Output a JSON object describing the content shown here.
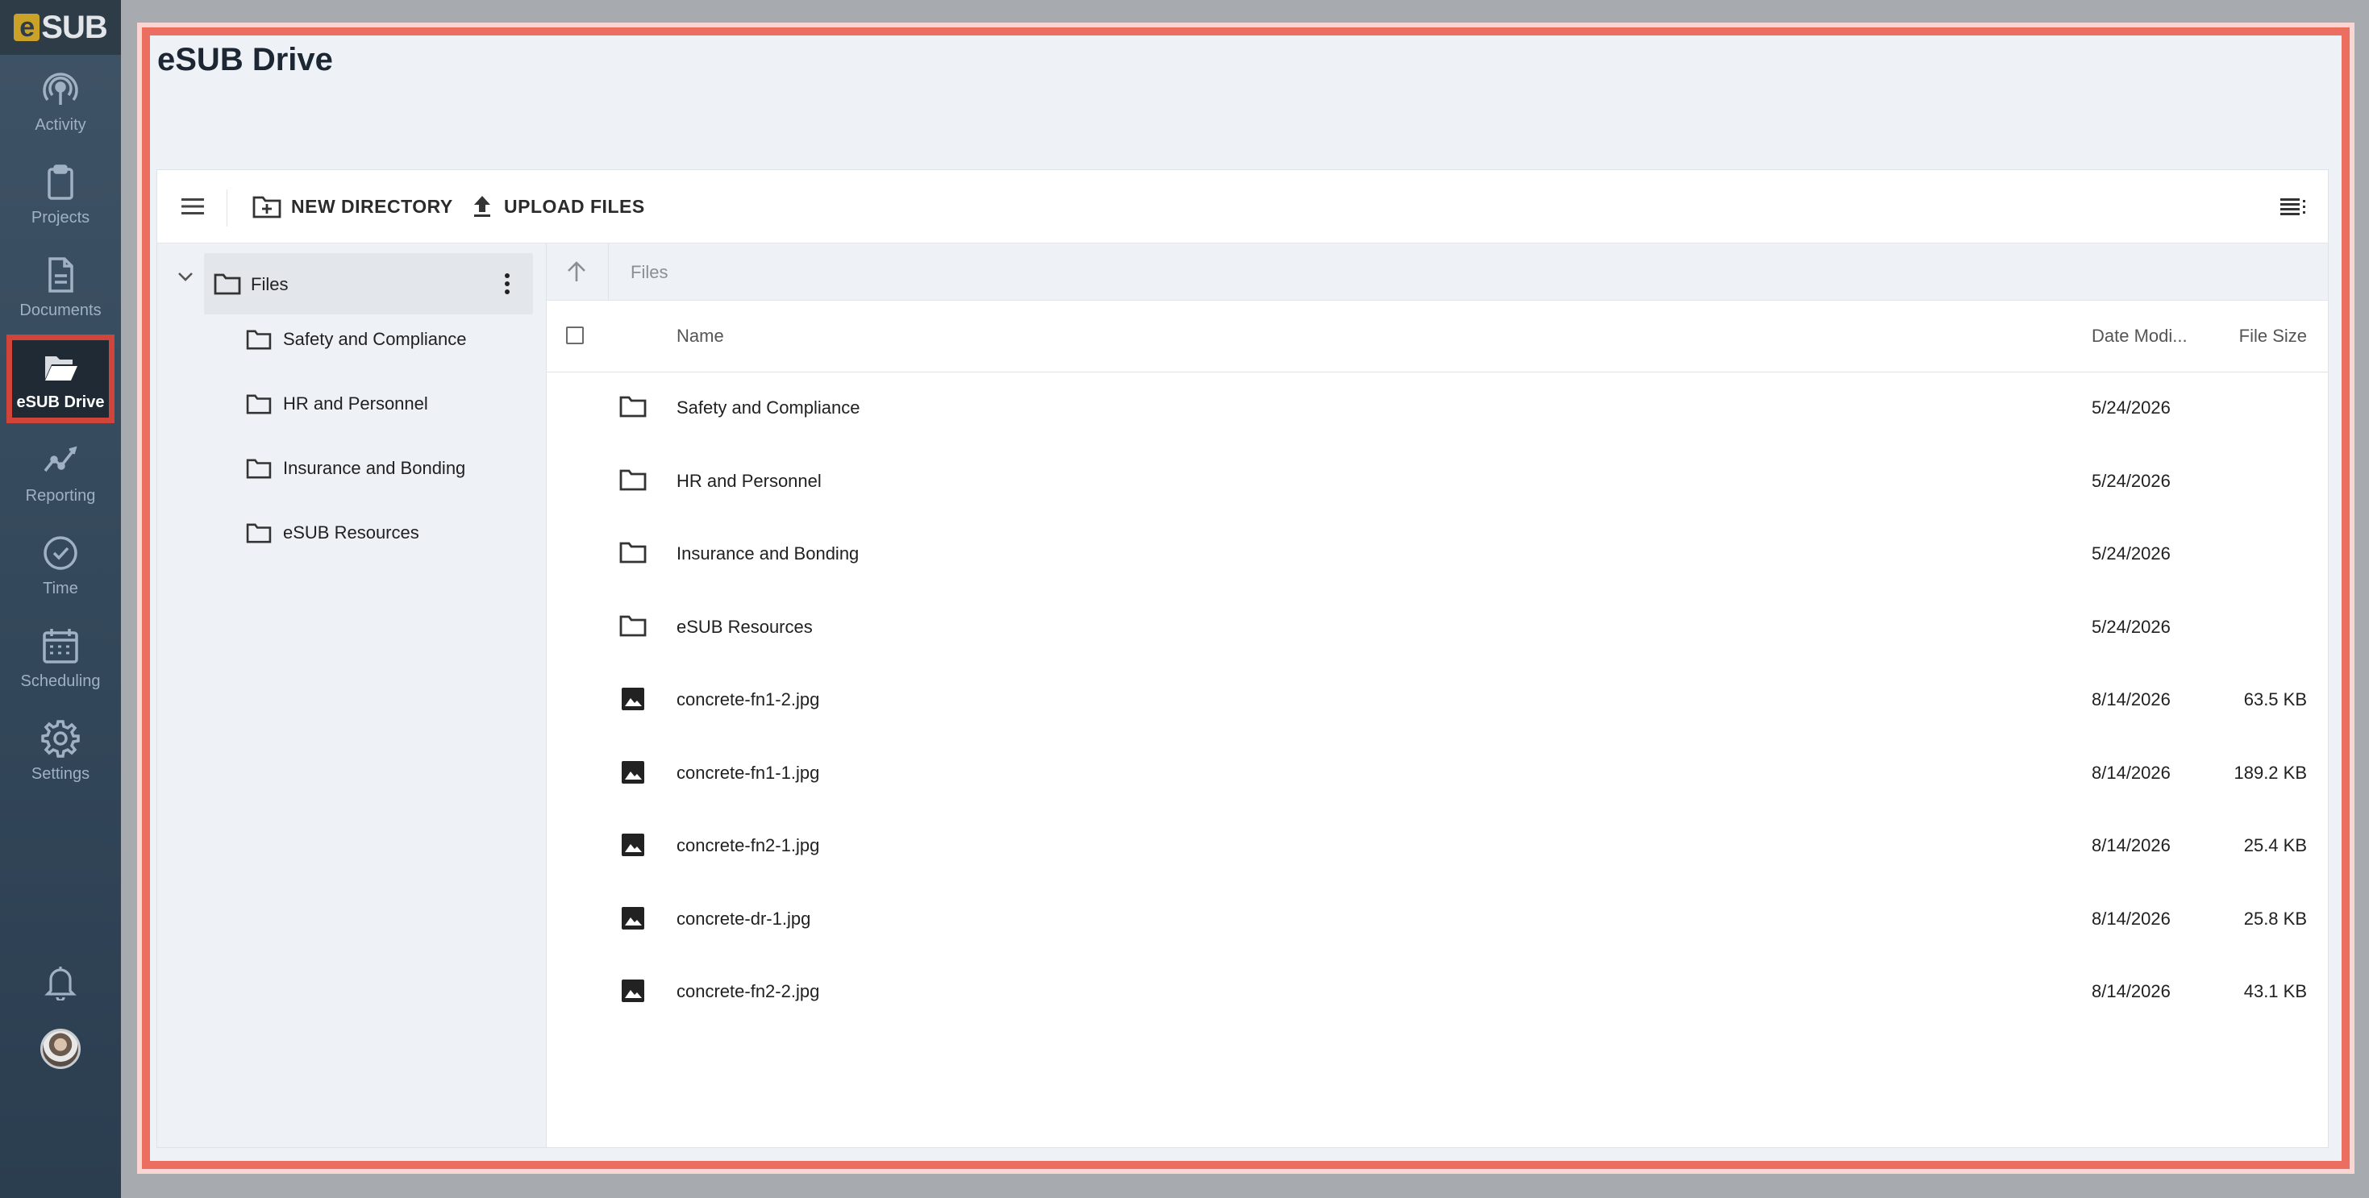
{
  "app": {
    "logo_text": "SUB",
    "logo_letter": "e",
    "accent": "#c9a227",
    "highlight": "#ec6e60"
  },
  "sidebar": {
    "items": [
      {
        "label": "Activity",
        "icon": "activity-icon"
      },
      {
        "label": "Projects",
        "icon": "clipboard-icon"
      },
      {
        "label": "Documents",
        "icon": "document-icon"
      },
      {
        "label": "eSUB Drive",
        "icon": "folder-open-icon",
        "active": true
      },
      {
        "label": "Reporting",
        "icon": "chart-line-icon"
      },
      {
        "label": "Time",
        "icon": "clock-icon"
      },
      {
        "label": "Scheduling",
        "icon": "calendar-icon"
      },
      {
        "label": "Settings",
        "icon": "gear-icon"
      }
    ]
  },
  "page": {
    "title": "eSUB Drive"
  },
  "toolbar": {
    "new_directory": "NEW DIRECTORY",
    "upload_files": "UPLOAD FILES"
  },
  "tree": {
    "root": "Files",
    "children": [
      "Safety and Compliance",
      "HR and Personnel",
      "Insurance and Bonding",
      "eSUB Resources"
    ]
  },
  "breadcrumb": {
    "path": "Files"
  },
  "table": {
    "columns": {
      "name": "Name",
      "date": "Date Modi...",
      "size": "File Size"
    },
    "rows": [
      {
        "type": "folder",
        "name": "Safety and Compliance",
        "date": "5/24/2026",
        "size": ""
      },
      {
        "type": "folder",
        "name": "HR and Personnel",
        "date": "5/24/2026",
        "size": ""
      },
      {
        "type": "folder",
        "name": "Insurance and Bonding",
        "date": "5/24/2026",
        "size": ""
      },
      {
        "type": "folder",
        "name": "eSUB Resources",
        "date": "5/24/2026",
        "size": ""
      },
      {
        "type": "image",
        "name": "concrete-fn1-2.jpg",
        "date": "8/14/2026",
        "size": "63.5 KB"
      },
      {
        "type": "image",
        "name": "concrete-fn1-1.jpg",
        "date": "8/14/2026",
        "size": "189.2 KB"
      },
      {
        "type": "image",
        "name": "concrete-fn2-1.jpg",
        "date": "8/14/2026",
        "size": "25.4 KB"
      },
      {
        "type": "image",
        "name": "concrete-dr-1.jpg",
        "date": "8/14/2026",
        "size": "25.8 KB"
      },
      {
        "type": "image",
        "name": "concrete-fn2-2.jpg",
        "date": "8/14/2026",
        "size": "43.1 KB"
      }
    ]
  }
}
